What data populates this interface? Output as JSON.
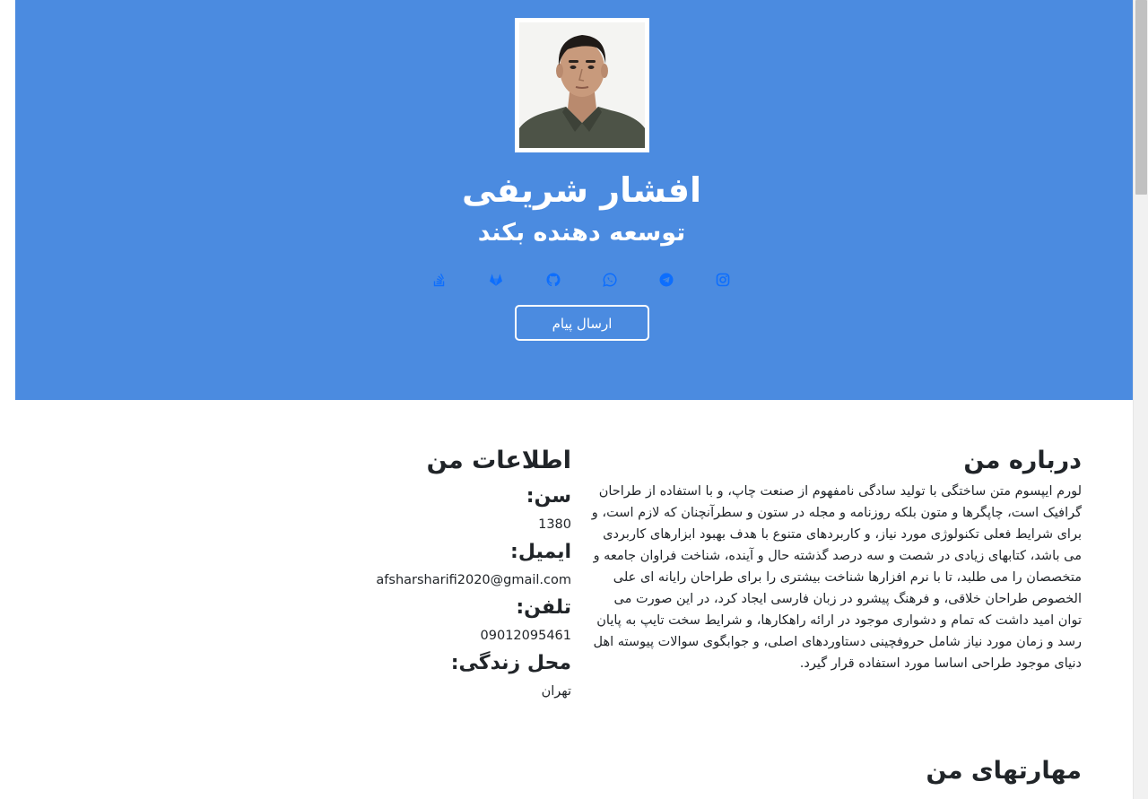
{
  "hero": {
    "name": "افشار شریفی",
    "role": "توسعه دهنده بکند",
    "send_button_label": "ارسال پیام",
    "background_color": "#4b8be0",
    "social_links": [
      {
        "icon": "instagram-icon"
      },
      {
        "icon": "telegram-icon"
      },
      {
        "icon": "whatsapp-icon"
      },
      {
        "icon": "github-icon"
      },
      {
        "icon": "gitlab-icon"
      },
      {
        "icon": "stackoverflow-icon"
      }
    ]
  },
  "about": {
    "title": "درباره من",
    "text": "لورم ایپسوم متن ساختگی با تولید سادگی نامفهوم از صنعت چاپ، و با استفاده از طراحان گرافیک است، چاپگرها و متون بلکه روزنامه و مجله در ستون و سطرآنچنان که لازم است، و برای شرایط فعلی تکنولوژی مورد نیاز، و کاربردهای متنوع با هدف بهبود ابزارهای کاربردی می باشد، کتابهای زیادی در شصت و سه درصد گذشته حال و آینده، شناخت فراوان جامعه و متخصصان را می طلبد، تا با نرم افزارها شناخت بیشتری را برای طراحان رایانه ای علی الخصوص طراحان خلاقی، و فرهنگ پیشرو در زبان فارسی ایجاد کرد، در این صورت می توان امید داشت که تمام و دشواری موجود در ارائه راهکارها، و شرایط سخت تایپ به پایان رسد و زمان مورد نیاز شامل حروفچینی دستاوردهای اصلی، و جوابگوی سوالات پیوسته اهل دنیای موجود طراحی اساسا مورد استفاده قرار گیرد."
  },
  "info": {
    "title": "اطلاعات من",
    "age_label": "سن:",
    "age_value": "1380",
    "email_label": "ایمیل:",
    "email_value": "afsharsharifi2020@gmail.com",
    "phone_label": "تلفن:",
    "phone_value": "09012095461",
    "location_label": "محل زندگی:",
    "location_value": "تهران"
  },
  "skills": {
    "title": "مهارتهای من"
  }
}
